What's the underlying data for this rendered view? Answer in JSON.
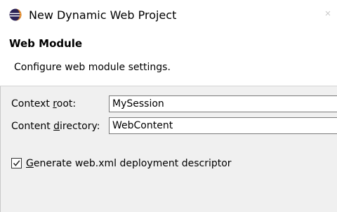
{
  "window": {
    "title": "New Dynamic Web Project"
  },
  "banner": {
    "title": "Web Module",
    "description": "Configure web module settings."
  },
  "form": {
    "context_root": {
      "label_before": "Context ",
      "label_mnemonic": "r",
      "label_after": "oot:",
      "value": "MySession"
    },
    "content_directory": {
      "label_before": "Content ",
      "label_mnemonic": "d",
      "label_after": "irectory:",
      "value": "WebContent"
    },
    "generate_descriptor": {
      "label_mnemonic": "G",
      "label_after": "enerate web.xml deployment descriptor",
      "checked": true
    }
  },
  "icons": {
    "app": "eclipse-icon",
    "checkbox_check": "checkmark-icon",
    "close": "close-icon"
  },
  "colors": {
    "background": "#f0f0f0",
    "banner": "#ffffff",
    "eclipse_purple": "#2c2255",
    "eclipse_accent": "#f7941e"
  }
}
